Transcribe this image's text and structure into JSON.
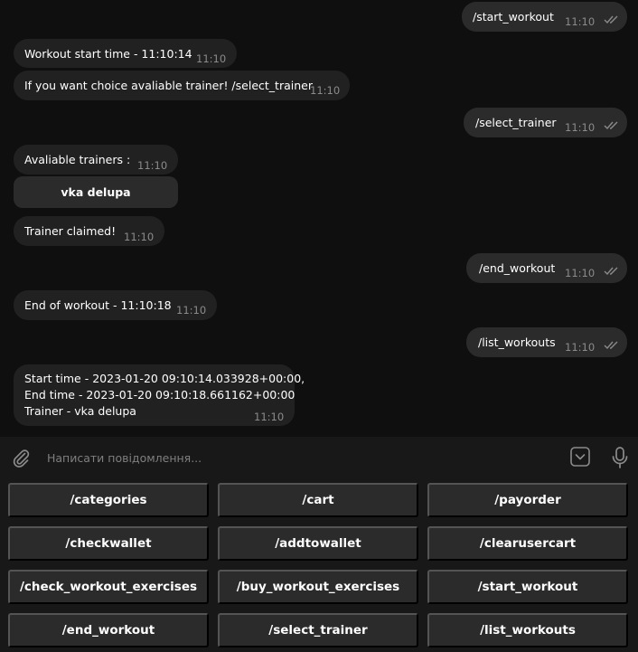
{
  "messages": [
    {
      "direction": "outgoing",
      "text": "/start_workout",
      "time": "11:10",
      "status": "read"
    },
    {
      "direction": "incoming",
      "text": "Workout start time - 11:10:14",
      "time": "11:10"
    },
    {
      "direction": "incoming",
      "text": "If you want choice avaliable trainer! /select_trainer",
      "time": "11:10"
    },
    {
      "direction": "outgoing",
      "text": "/select_trainer",
      "time": "11:10",
      "status": "read"
    },
    {
      "direction": "incoming",
      "text": "Avaliable trainers :",
      "time": "11:10",
      "inline_buttons": [
        "vka delupa"
      ]
    },
    {
      "direction": "incoming",
      "text": "Trainer claimed!",
      "time": "11:10"
    },
    {
      "direction": "outgoing",
      "text": "/end_workout",
      "time": "11:10",
      "status": "read"
    },
    {
      "direction": "incoming",
      "text": "End of workout - 11:10:18",
      "time": "11:10"
    },
    {
      "direction": "outgoing",
      "text": "/list_workouts",
      "time": "11:10",
      "status": "read"
    },
    {
      "direction": "incoming",
      "lines": [
        "Start time - 2023-01-20 09:10:14.033928+00:00,",
        "End time - 2023-01-20 09:10:18.661162+00:00",
        "Trainer - vka delupa"
      ],
      "time": "11:10"
    }
  ],
  "composer": {
    "placeholder": "Написати повідомлення..."
  },
  "keyboard": {
    "rows": [
      [
        "/categories",
        "/cart",
        "/payorder"
      ],
      [
        "/checkwallet",
        "/addtowallet",
        "/clearusercart"
      ],
      [
        "/check_workout_exercises",
        "/buy_workout_exercises",
        "/start_workout"
      ],
      [
        "/end_workout",
        "/select_trainer",
        "/list_workouts"
      ]
    ]
  },
  "icons": {
    "attach": "paperclip-icon",
    "keyboard_toggle": "keyboard-toggle-icon",
    "voice": "microphone-icon",
    "read_status": "double-check-icon"
  },
  "colors": {
    "background": "#0f0f0f",
    "bubble_in": "#212121",
    "bubble_out": "#2b2b2b",
    "panel": "#181818",
    "button": "#2b2b2b",
    "meta_text": "#8b8b8b"
  }
}
